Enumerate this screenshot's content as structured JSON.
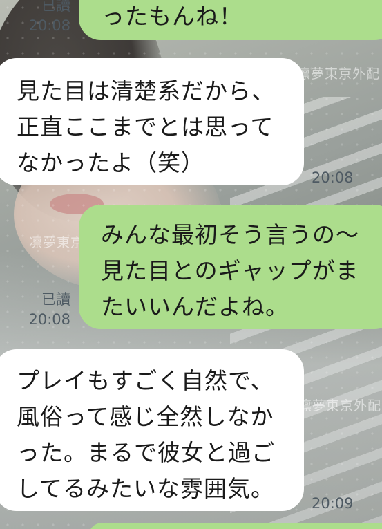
{
  "chat": {
    "watermark": "凛夢東京外配",
    "messages": [
      {
        "side": "sent",
        "lines": [
          "ったもんね！"
        ],
        "read": "已讀",
        "time": "20:08"
      },
      {
        "side": "received",
        "lines": [
          "見た目は清楚系だから、",
          "正直ここまでとは思って",
          "なかったよ（笑）"
        ],
        "time": "20:08"
      },
      {
        "side": "sent",
        "lines": [
          "みんな最初そう言うの〜",
          "見た目とのギャップがま",
          "たいいんだよね。"
        ],
        "read": "已讀",
        "time": "20:08"
      },
      {
        "side": "received",
        "lines": [
          "プレイもすごく自然で、",
          "風俗って感じ全然しなか",
          "った。まるで彼女と過ご",
          "してるみたいな雰囲気。"
        ],
        "time": "20:09"
      }
    ]
  },
  "colors": {
    "sent_bubble": "#acdd8c",
    "received_bubble": "#ffffff",
    "meta_text": "#4e5a63"
  }
}
